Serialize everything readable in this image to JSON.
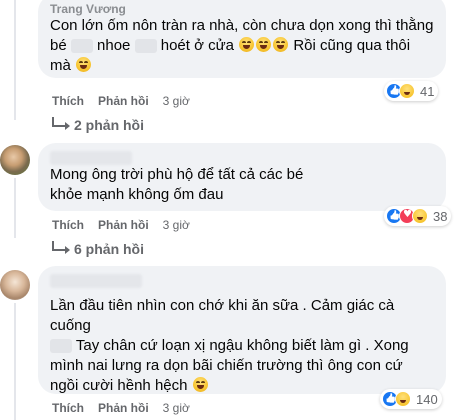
{
  "comments": [
    {
      "author": "Trang Vương",
      "text_parts": [
        "Con lớn ốm nôn tràn ra nhà, còn chưa dọn xong thì thằng bé ",
        " nhoe ",
        " hoét ở cửa ",
        " Rồi cũng qua thôi mà "
      ],
      "actions": {
        "like": "Thích",
        "reply": "Phản hồi",
        "time": "3 giờ"
      },
      "reaction_count": "41",
      "replies": "2 phản hồi"
    },
    {
      "text": "Mong ông trời phù hộ để tất cả các bé khỏe mạnh không ốm đau",
      "actions": {
        "like": "Thích",
        "reply": "Phản hồi",
        "time": "3 giờ"
      },
      "reaction_count": "38",
      "replies": "6 phản hồi"
    },
    {
      "text_line1": "Lần đầu tiên nhìn con chớ khi ăn sữa . Cảm giác cà cuống",
      "text_line2": " Tay chân cứ loạn xị ngậu không biết làm gì . Xong",
      "text_line3": "mình nai lưng ra dọn bãi chiến trường thì ông con cứ",
      "text_line4": "ngồi cười hềnh hệch ",
      "actions": {
        "like": "Thích",
        "reply": "Phản hồi",
        "time": "3 giờ"
      },
      "reaction_count": "140"
    }
  ],
  "icons": {
    "like": "like-reaction-icon",
    "love": "love-reaction-icon",
    "haha": "haha-reaction-icon"
  },
  "colors": {
    "bubble": "#f0f2f5",
    "secondary_text": "#65676b",
    "like_blue": "#1877f2",
    "love_red": "#f33e58"
  }
}
